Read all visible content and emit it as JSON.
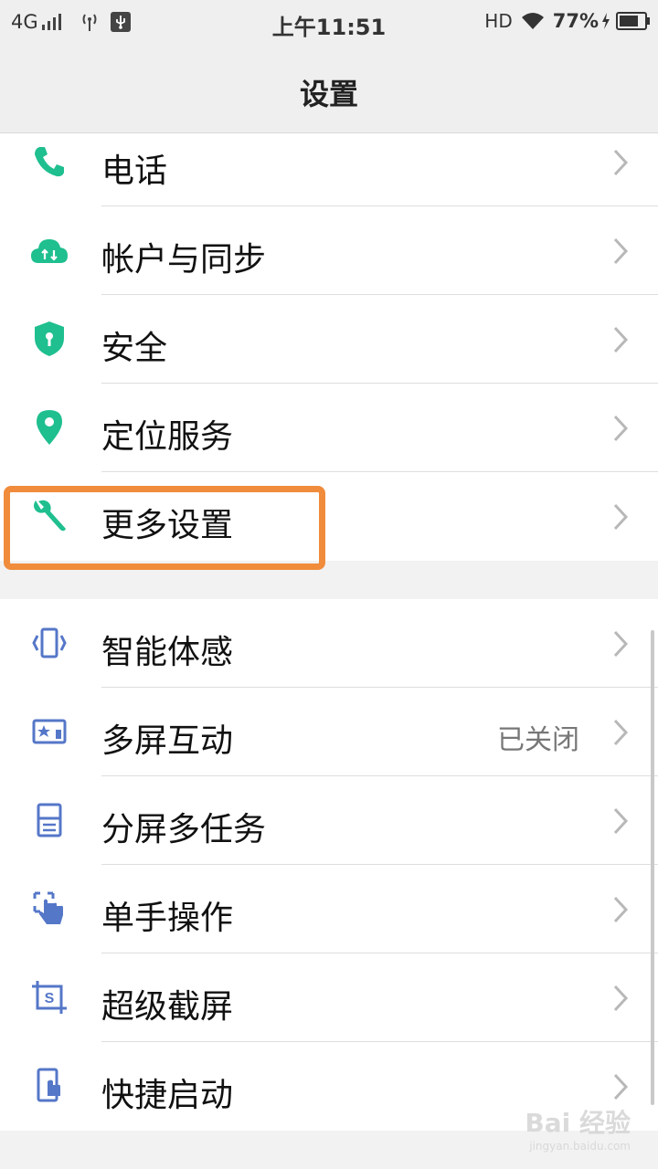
{
  "status_bar": {
    "network": "4G",
    "time": "上午11:51",
    "hd": "HD",
    "battery_pct": "77%",
    "battery_level": 0.77,
    "icons": [
      "signal-icon",
      "hotspot-icon",
      "usb-icon",
      "wifi-icon",
      "charging-icon",
      "battery-icon"
    ]
  },
  "header": {
    "title": "设置"
  },
  "group1": [
    {
      "label": "电话",
      "icon": "phone-icon"
    },
    {
      "label": "帐户与同步",
      "icon": "cloud-sync-icon"
    },
    {
      "label": "安全",
      "icon": "shield-icon"
    },
    {
      "label": "定位服务",
      "icon": "location-pin-icon"
    },
    {
      "label": "更多设置",
      "icon": "wrench-icon"
    }
  ],
  "group2": [
    {
      "label": "智能体感",
      "icon": "motion-sense-icon"
    },
    {
      "label": "多屏互动",
      "icon": "multi-screen-icon",
      "value": "已关闭"
    },
    {
      "label": "分屏多任务",
      "icon": "split-screen-icon"
    },
    {
      "label": "单手操作",
      "icon": "one-hand-icon"
    },
    {
      "label": "超级截屏",
      "icon": "screenshot-icon"
    },
    {
      "label": "快捷启动",
      "icon": "quick-launch-icon"
    }
  ],
  "colors": {
    "accent_green": "#1fbf8f",
    "accent_blue": "#5577c8",
    "highlight": "#f08c3c"
  },
  "watermark": {
    "brand": "Bai 经验",
    "url": "jingyan.baidu.com"
  }
}
